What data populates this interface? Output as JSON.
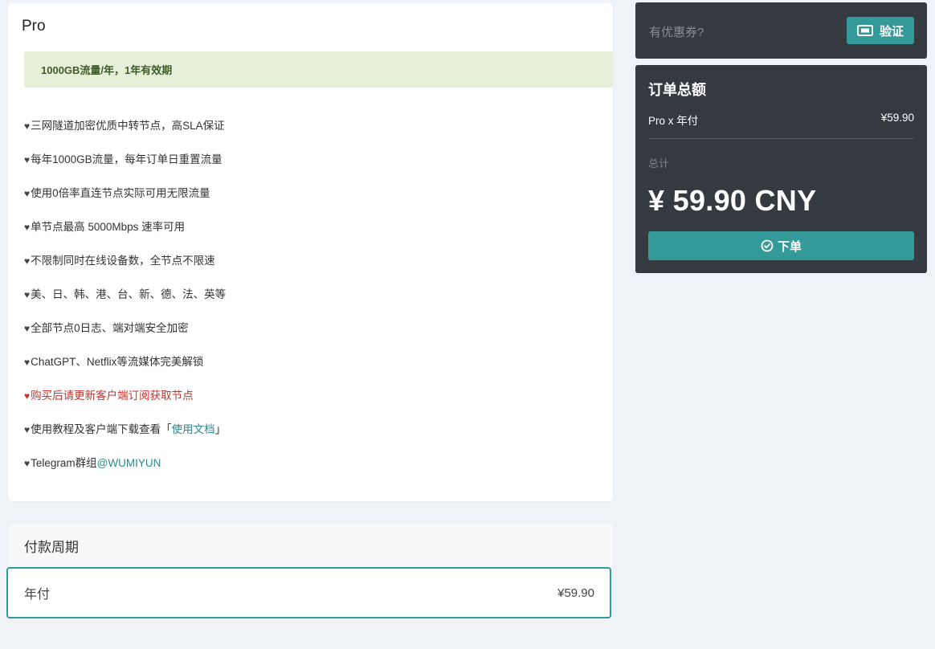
{
  "plan": {
    "title": "Pro",
    "alert": "1000GB流量/年，1年有效期",
    "heart_glyph": "♥",
    "features": [
      {
        "text": "三网隧道加密优质中转节点，高SLA保证"
      },
      {
        "text": "每年1000GB流量，每年订单日重置流量"
      },
      {
        "text": "使用0倍率直连节点实际可用无限流量"
      },
      {
        "text": "单节点最高 5000Mbps 速率可用"
      },
      {
        "text": "不限制同时在线设备数，全节点不限速"
      },
      {
        "text": "美、日、韩、港、台、新、德、法、英等"
      },
      {
        "text": "全部节点0日志、端对端安全加密"
      },
      {
        "text": "ChatGPT、Netflix等流媒体完美解锁"
      },
      {
        "text": "购买后请更新客户端订阅获取节点"
      },
      {
        "text": "使用教程及客户端下载查看「",
        "link": "使用文档",
        "suffix": "」"
      },
      {
        "text": "Telegram群组",
        "link": "@WUMIYUN"
      }
    ]
  },
  "period": {
    "title": "付款周期",
    "option_name": "年付",
    "option_price": "¥59.90"
  },
  "coupon": {
    "placeholder": "有优惠券?",
    "verify_label": "验证"
  },
  "order": {
    "title": "订单总额",
    "line_item": "Pro x 年付",
    "line_price": "¥59.90",
    "total_label": "总计",
    "total_amount": "¥ 59.90 CNY",
    "submit_label": "下单"
  },
  "colors": {
    "accent": "#349a99",
    "dark_panel": "#343a40",
    "alert_bg": "#e6efd9",
    "warning_text": "#c8312b"
  },
  "icons": {
    "verify": "ticket-icon",
    "submit": "check-circle-icon"
  }
}
